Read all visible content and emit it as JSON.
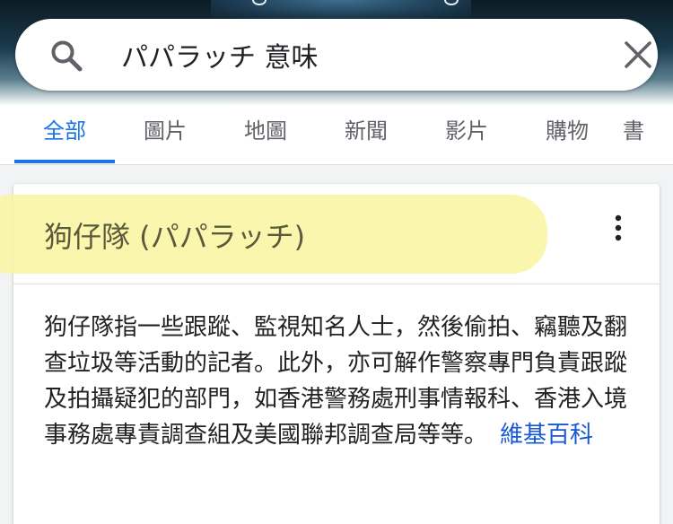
{
  "search": {
    "query": "パパラッチ 意味"
  },
  "tabs": [
    {
      "label": "全部",
      "active": true
    },
    {
      "label": "圖片",
      "active": false
    },
    {
      "label": "地圖",
      "active": false
    },
    {
      "label": "新聞",
      "active": false
    },
    {
      "label": "影片",
      "active": false
    },
    {
      "label": "購物",
      "active": false
    },
    {
      "label": "書",
      "active": false
    }
  ],
  "knowledge_card": {
    "title": "狗仔隊 (パパラッチ)",
    "description": "狗仔隊指一些跟蹤、監視知名人士，然後偷拍、竊聽及翻查垃圾等活動的記者。此外，亦可解作警察專門負責跟蹤及拍攝疑犯的部門，如香港警務處刑事情報科、香港入境事務處專責調查組及美國聯邦調查局等等。",
    "source_label": "維基百科"
  },
  "colors": {
    "accent": "#1a73e8",
    "highlight": "#faf5a0",
    "link": "#1558d6"
  },
  "icons": [
    "search-icon",
    "clear-icon",
    "more-vert-icon"
  ]
}
